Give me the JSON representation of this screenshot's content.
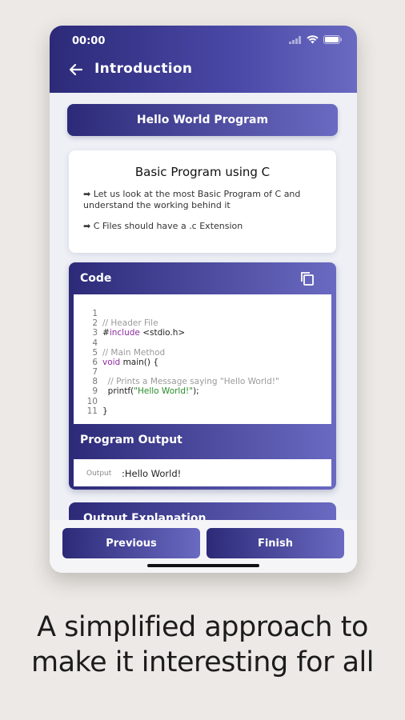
{
  "status_bar": {
    "time": "00:00"
  },
  "app_bar": {
    "title": "Introduction"
  },
  "lesson": {
    "header_button": "Hello World Program",
    "intro": {
      "title": "Basic Program using C",
      "bullets": [
        "➡  Let us look at the most Basic Program of C and understand the working behind it",
        "➡   C Files should have a .c Extension"
      ]
    },
    "code": {
      "label": "Code",
      "line_numbers": [
        "1",
        "2",
        "3",
        "4",
        "5",
        "6",
        "7",
        "8",
        "9",
        "10",
        "11"
      ],
      "lines": [
        "",
        "// Header File",
        "#include <stdio.h>",
        "",
        "// Main Method",
        "void main() {",
        "",
        "  // Prints a Message saying \"Hello World!\"",
        "  printf(\"Hello World!\");",
        "",
        "}"
      ]
    },
    "output": {
      "label": "Program Output",
      "prefix": "Output",
      "value": ":Hello World!"
    },
    "explanation": {
      "label": "Output Explanation"
    }
  },
  "navigation": {
    "previous": "Previous",
    "finish": "Finish"
  },
  "tagline": {
    "line1": "A simplified approach to",
    "line2": "make it interesting for all"
  },
  "colors": {
    "primary_dark": "#2c2a78",
    "primary_light": "#6a6ac2",
    "keyword": "#8e2aa0",
    "string": "#2a8a2a",
    "comment": "#9a9a9a"
  }
}
